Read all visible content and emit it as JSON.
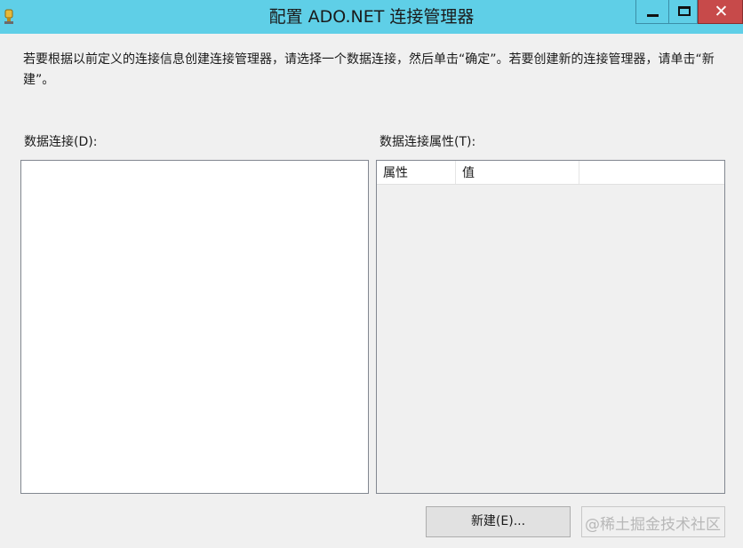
{
  "window": {
    "title": "配置 ADO.NET 连接管理器",
    "close_glyph": "✕"
  },
  "instructions": "若要根据以前定义的连接信息创建连接管理器，请选择一个数据连接，然后单击“确定”。若要创建新的连接管理器，请单击“新建”。",
  "data_connections": {
    "label": "数据连接(D):",
    "items": []
  },
  "connection_properties": {
    "label": "数据连接属性(T):",
    "columns": [
      "属性",
      "值"
    ],
    "rows": []
  },
  "buttons": {
    "new_label": "新建(E)..."
  },
  "watermark": "@稀土掘金技术社区",
  "colors": {
    "titlebar": "#5fcfe7",
    "close_button": "#c74a4a"
  },
  "icons": {
    "app": "ssis-connection-icon",
    "minimize": "minimize-icon",
    "maximize": "maximize-icon",
    "close": "close-icon"
  }
}
